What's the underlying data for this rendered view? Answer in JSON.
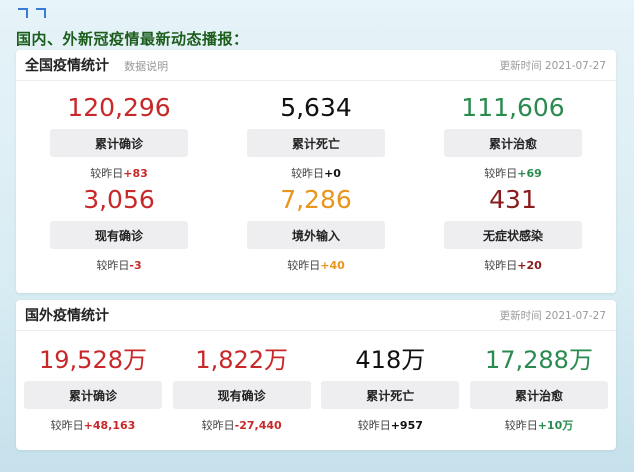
{
  "headline": "国内、外新冠疫情最新动态播报：",
  "domestic": {
    "title": "全国疫情统计",
    "subtitle": "数据说明",
    "updated": "更新时间 2021-07-27",
    "stats": [
      {
        "value": "120,296",
        "label": "累计确诊",
        "delta_prefix": "较昨日",
        "delta": "+83",
        "color": "#c8282a"
      },
      {
        "value": "5,634",
        "label": "累计死亡",
        "delta_prefix": "较昨日",
        "delta": "+0",
        "color": "#111111"
      },
      {
        "value": "111,606",
        "label": "累计治愈",
        "delta_prefix": "较昨日",
        "delta": "+69",
        "color": "#2a8a50"
      },
      {
        "value": "3,056",
        "label": "现有确诊",
        "delta_prefix": "较昨日",
        "delta": "-3",
        "color": "#c8282a"
      },
      {
        "value": "7,286",
        "label": "境外输入",
        "delta_prefix": "较昨日",
        "delta": "+40",
        "color": "#e8961e"
      },
      {
        "value": "431",
        "label": "无症状感染",
        "delta_prefix": "较昨日",
        "delta": "+20",
        "color": "#8a1c1c"
      }
    ]
  },
  "foreign": {
    "title": "国外疫情统计",
    "updated": "更新时间 2021-07-27",
    "stats": [
      {
        "value": "19,528万",
        "label": "累计确诊",
        "delta_prefix": "较昨日",
        "delta": "+48,163",
        "color": "#c8282a"
      },
      {
        "value": "1,822万",
        "label": "现有确诊",
        "delta_prefix": "较昨日",
        "delta": "-27,440",
        "color": "#c8282a"
      },
      {
        "value": "418万",
        "label": "累计死亡",
        "delta_prefix": "较昨日",
        "delta": "+957",
        "color": "#111111"
      },
      {
        "value": "17,288万",
        "label": "累计治愈",
        "delta_prefix": "较昨日",
        "delta": "+10万",
        "color": "#2a8a50"
      }
    ]
  }
}
